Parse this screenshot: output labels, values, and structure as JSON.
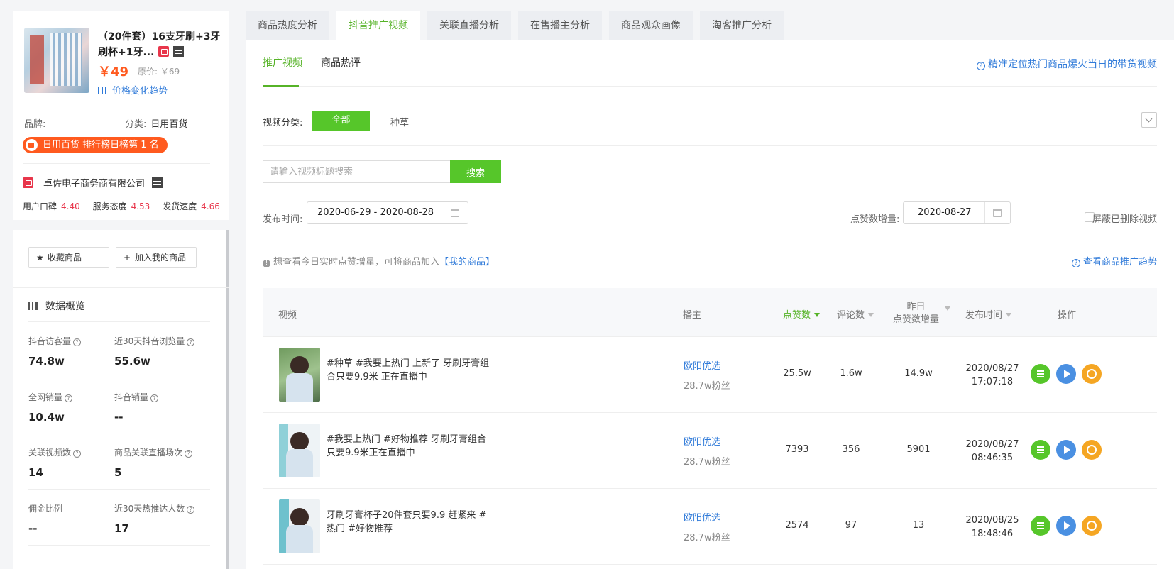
{
  "product": {
    "title": "（20件套）16支牙刷+3牙刷杯+1牙...",
    "price": "￥49",
    "original_price": "原价: ￥69",
    "trend_link": "价格变化趋势",
    "brand_label": "品牌:",
    "brand_value": "",
    "category_label": "分类:",
    "category_value": "日用百货",
    "rank_badge": "日用百货 排行榜日榜第 1 名"
  },
  "seller": {
    "name": "卓佐电子商务商有限公司",
    "scores": [
      {
        "label": "用户口碑",
        "value": "4.40"
      },
      {
        "label": "服务态度",
        "value": "4.53"
      },
      {
        "label": "发货速度",
        "value": "4.66"
      }
    ]
  },
  "actions": {
    "favorite": "收藏商品",
    "add_mine": "加入我的商品"
  },
  "overview": {
    "title": "数据概览",
    "stats": [
      {
        "label": "抖音访客量",
        "value": "74.8w"
      },
      {
        "label": "近30天抖音浏览量",
        "value": "55.6w"
      },
      {
        "label": "全网销量",
        "value": "10.4w"
      },
      {
        "label": "抖音销量",
        "value": "--"
      },
      {
        "label": "关联视频数",
        "value": "14"
      },
      {
        "label": "商品关联直播场次",
        "value": "5"
      },
      {
        "label": "佣金比例",
        "value": "--"
      },
      {
        "label": "近30天热推达人数",
        "value": "17"
      }
    ]
  },
  "tabs": [
    "商品热度分析",
    "抖音推广视频",
    "关联直播分析",
    "在售播主分析",
    "商品观众画像",
    "淘客推广分析"
  ],
  "subtabs": [
    "推广视频",
    "商品热评"
  ],
  "help_link": "精准定位热门商品爆火当日的带货视频",
  "filters": {
    "category_label": "视频分类:",
    "all": "全部",
    "other": "种草",
    "search_placeholder": "请输入视频标题搜索",
    "search_button": "搜索",
    "publish_label": "发布时间:",
    "publish_range": "2020-06-29 - 2020-08-28",
    "likes_label": "点赞数增量:",
    "likes_date": "2020-08-27",
    "hide_deleted": "屏蔽已删除视频"
  },
  "notice": {
    "text": "想查看今日实时点赞增量，可将商品加入",
    "link": "【我的商品】",
    "trend_link": "查看商品推广趋势"
  },
  "table": {
    "headers": {
      "video": "视频",
      "anchor": "播主",
      "likes": "点赞数",
      "comments": "评论数",
      "yesterday_top": "昨日",
      "yesterday_bottom": "点赞数增量",
      "time": "发布时间",
      "ops": "操作"
    },
    "rows": [
      {
        "title": "#种草 #我要上热门 上新了 牙刷牙膏组合只要9.9米 正在直播中",
        "anchor": "欧阳优选",
        "fans": "28.7w粉丝",
        "likes": "25.5w",
        "comments": "1.6w",
        "increase": "14.9w",
        "date": "2020/08/27",
        "time": "17:07:18"
      },
      {
        "title": "#我要上热门 #好物推荐 牙刷牙膏组合只要9.9米正在直播中",
        "anchor": "欧阳优选",
        "fans": "28.7w粉丝",
        "likes": "7393",
        "comments": "356",
        "increase": "5901",
        "date": "2020/08/27",
        "time": "08:46:35"
      },
      {
        "title": "牙刷牙膏杯子20件套只要9.9 赶紧来 #热门 #好物推荐",
        "anchor": "欧阳优选",
        "fans": "28.7w粉丝",
        "likes": "2574",
        "comments": "97",
        "increase": "13",
        "date": "2020/08/25",
        "time": "18:48:46"
      }
    ]
  },
  "colors": {
    "accent": "#56b327",
    "link": "#2f7ad9",
    "badge": "#ff5a1f"
  }
}
